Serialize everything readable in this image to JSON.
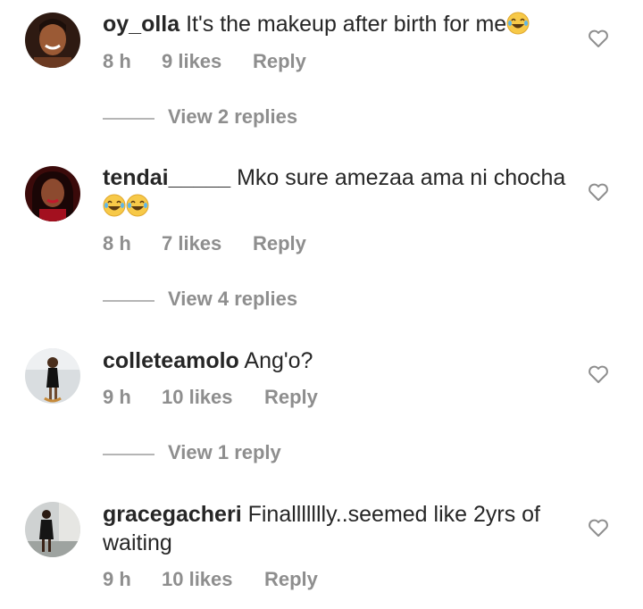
{
  "comments": [
    {
      "username": "oy_olla",
      "text": " It's the makeup after birth for me",
      "emoji_count": 1,
      "emoji": "😂",
      "time": "8 h",
      "likes": "9 likes",
      "reply_label": "Reply",
      "view_replies": "View 2 replies"
    },
    {
      "username": "tendai_____",
      "text": " Mko sure amezaa ama ni chocha",
      "emoji_count": 2,
      "emoji": "😂",
      "time": "8 h",
      "likes": "7 likes",
      "reply_label": "Reply",
      "view_replies": "View 4 replies"
    },
    {
      "username": "colleteamolo",
      "text": " Ang'o?",
      "emoji_count": 0,
      "time": "9 h",
      "likes": "10 likes",
      "reply_label": "Reply",
      "view_replies": "View 1 reply"
    },
    {
      "username": "gracegacheri",
      "text": " Finallllllly..seemed like 2yrs of waiting",
      "emoji_count": 0,
      "time": "9 h",
      "likes": "10 likes",
      "reply_label": "Reply"
    }
  ],
  "icons": {
    "like": "heart-outline-icon",
    "emoji": "tears-of-joy-emoji"
  },
  "colors": {
    "text": "#262626",
    "meta": "#8e8e8e",
    "heart": "#8e8e8e",
    "emoji": "#f7c948"
  }
}
